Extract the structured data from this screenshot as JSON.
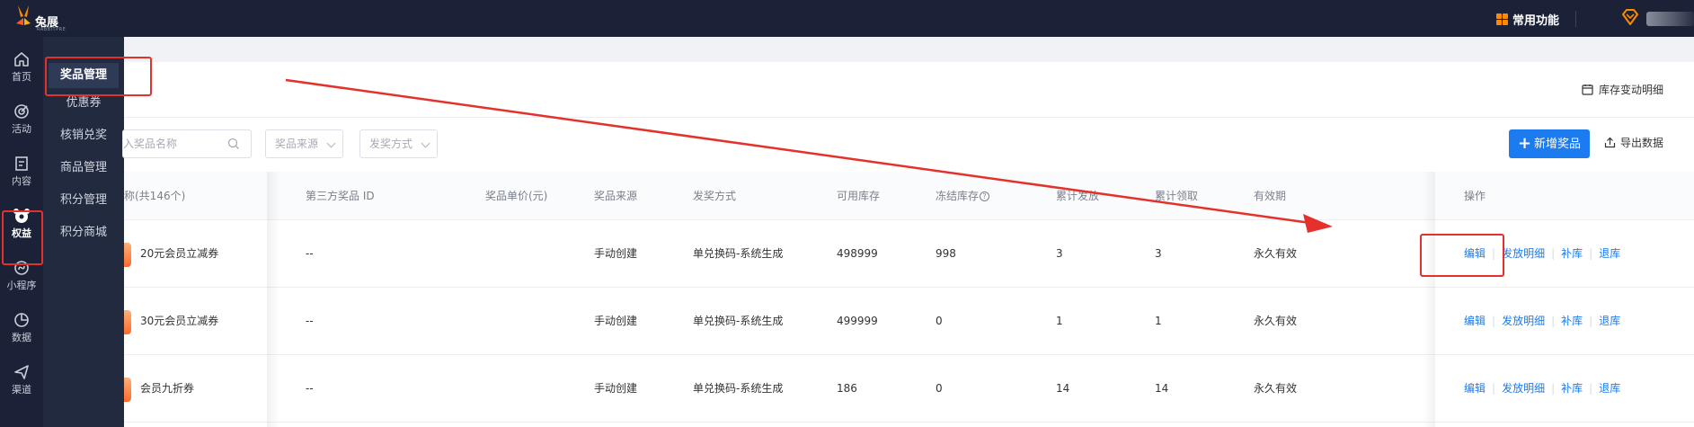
{
  "topbar": {
    "brand": "兔展",
    "brand_sub": "RABBITPRE",
    "common_functions": "常用功能"
  },
  "leftnav": [
    {
      "label": "首页",
      "icon": "home-icon"
    },
    {
      "label": "活动",
      "icon": "target-icon"
    },
    {
      "label": "内容",
      "icon": "document-icon"
    },
    {
      "label": "权益",
      "icon": "benefit-icon"
    },
    {
      "label": "小程序",
      "icon": "mini-program-icon"
    },
    {
      "label": "数据",
      "icon": "pie-chart-icon"
    },
    {
      "label": "渠道",
      "icon": "send-icon"
    }
  ],
  "subnav": [
    {
      "label": "奖品管理"
    },
    {
      "label": "优惠券"
    },
    {
      "label": "核销兑奖"
    },
    {
      "label": "商品管理"
    },
    {
      "label": "积分管理"
    },
    {
      "label": "积分商城"
    }
  ],
  "header": {
    "stock_detail": "库存变动明细"
  },
  "filters": {
    "search_placeholder": "入奖品名称",
    "source_placeholder": "奖品来源",
    "method_placeholder": "发奖方式",
    "add_button": "新增奖品",
    "add_icon": "+",
    "export_button": "导出数据"
  },
  "table": {
    "columns": {
      "name": "称(共146个)",
      "third_party_id": "第三方奖品 ID",
      "unit_price": "奖品单价(元)",
      "source": "奖品来源",
      "method": "发奖方式",
      "available": "可用库存",
      "frozen": "冻结库存",
      "frozen_info_icon": "?",
      "issued": "累计发放",
      "claimed": "累计领取",
      "validity": "有效期",
      "actions": "操作"
    },
    "rows": [
      {
        "name": "20元会员立减券",
        "third_party_id": "--",
        "unit_price": "",
        "source": "手动创建",
        "method": "单兑换码-系统生成",
        "available": "498999",
        "frozen": "998",
        "issued": "3",
        "claimed": "3",
        "validity": "永久有效"
      },
      {
        "name": "30元会员立减券",
        "third_party_id": "--",
        "unit_price": "",
        "source": "手动创建",
        "method": "单兑换码-系统生成",
        "available": "499999",
        "frozen": "0",
        "issued": "1",
        "claimed": "1",
        "validity": "永久有效"
      },
      {
        "name": "会员九折券",
        "third_party_id": "--",
        "unit_price": "",
        "source": "手动创建",
        "method": "单兑换码-系统生成",
        "available": "186",
        "frozen": "0",
        "issued": "14",
        "claimed": "14",
        "validity": "永久有效"
      }
    ],
    "actions": {
      "edit": "编辑",
      "issue_detail": "发放明细",
      "restock": "补库",
      "return": "退库",
      "separator": "|"
    }
  },
  "colors": {
    "topbar": "#1b2237",
    "primary": "#1d7bf0",
    "annotation": "#e4312b",
    "accent": "#ff8a00"
  }
}
